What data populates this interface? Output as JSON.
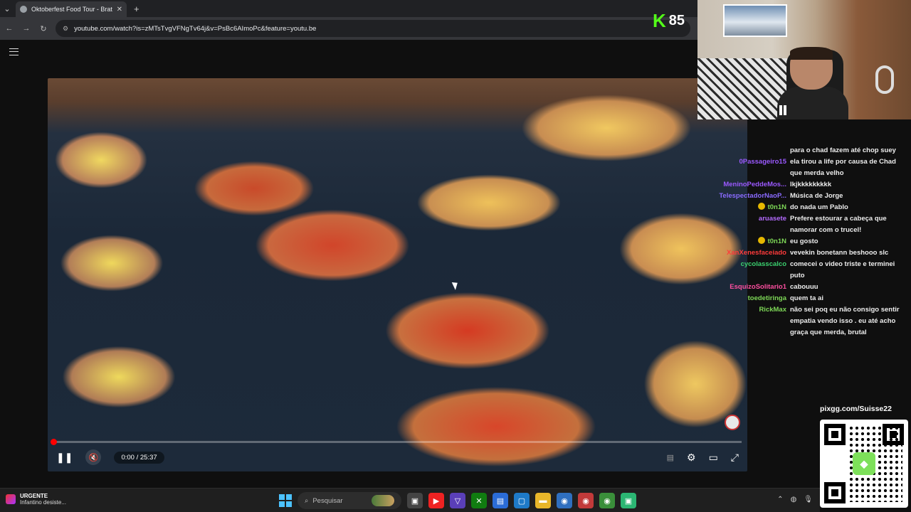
{
  "browser": {
    "tab_title": "Oktoberfest Food Tour - Bratw...",
    "tab_close": "✕",
    "new_tab": "+",
    "url": "youtube.com/watch?is=zMTsTvgVFNgTv64j&v=PsBc6AImoPc&feature=youtu.be"
  },
  "player": {
    "time": "0:00 / 25:37",
    "progress_fraction": 0.0
  },
  "overlay": {
    "k_logo": "K",
    "k_count": "85"
  },
  "chat": [
    {
      "user": "",
      "text": "para o chad fazem até chop suey",
      "color": "#ffffff"
    },
    {
      "user": "0Passageiro15",
      "text": "ela tirou a life por causa de Chad que merda velho",
      "color": "#9b59ff"
    },
    {
      "user": "MeninoPeddeMos...",
      "text": "lkjkkkkkkkkk",
      "color": "#9b59ff"
    },
    {
      "user": "TelespectadorNaoP...",
      "text": "Música de Jorge",
      "color": "#8a6bff"
    },
    {
      "user": "t0n1N",
      "text": "do nada um Pablo",
      "color": "#7ed957",
      "badge": true
    },
    {
      "user": "aruasete",
      "text": "Prefere estourar a cabeça que namorar com o trucel!",
      "color": "#b46bff"
    },
    {
      "user": "t0n1N",
      "text": "eu gosto",
      "color": "#7ed957",
      "badge": true
    },
    {
      "user": "XanXenesfaceiado",
      "text": "vevekin bonetann beshooo slc",
      "color": "#ff3b3b"
    },
    {
      "user": "cycolasscalco",
      "text": "comecei o video triste e terminei puto",
      "color": "#3bd16f"
    },
    {
      "user": "EsquizoSolitario1",
      "text": "cabouuu",
      "color": "#ff4fa0"
    },
    {
      "user": "toedetiringa",
      "text": "quem ta ai",
      "color": "#7ed957"
    },
    {
      "user": "RickMax",
      "text": "não sei poq eu não consigo sentir empatia vendo isso . eu até acho graça que merda, brutal",
      "color": "#7ed957"
    }
  ],
  "qr": {
    "url": "pixgg.com/Suisse22"
  },
  "taskbar": {
    "news_title": "URGENTE",
    "news_sub": "Infantino desiste...",
    "search_placeholder": "Pesquisar"
  },
  "icons": {
    "play_pause": "❚❚",
    "volume": "🔇",
    "settings": "⚙",
    "miniplayer": "▭",
    "fullscreen": "⤢",
    "subtitles": "▤"
  }
}
